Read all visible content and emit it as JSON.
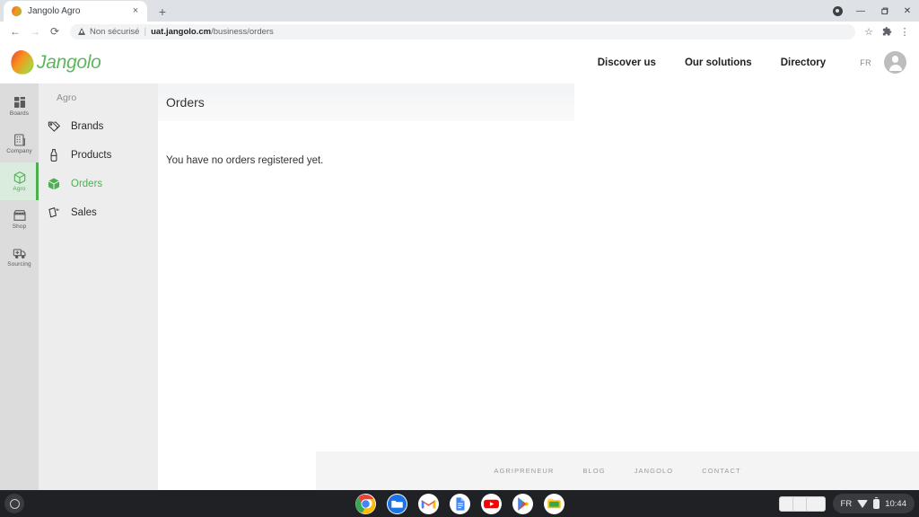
{
  "browser": {
    "tab": {
      "title": "Jangolo Agro",
      "favicon": "mango-favicon",
      "close": "×"
    },
    "newtab_label": "+",
    "window_controls": {
      "profile": "profile-dot",
      "minimize": "—",
      "maximize": "❐",
      "close": "✕"
    },
    "nav": {
      "back": "←",
      "forward": "→",
      "reload": "⟳"
    },
    "omnibox": {
      "security_label": "Non sécurisé",
      "separator": "|",
      "url_host": "uat.jangolo.cm",
      "url_path": "/business/orders"
    },
    "toolbar_icons": {
      "bookmark": "☆",
      "extensions": "puzzle-icon",
      "menu": "⋮"
    }
  },
  "site": {
    "logo_text": "Jangolo",
    "nav_links": [
      {
        "label": "Discover us"
      },
      {
        "label": "Our solutions"
      },
      {
        "label": "Directory"
      }
    ],
    "language": "FR",
    "account": "account-avatar"
  },
  "rail": {
    "items": [
      {
        "label": "Boards",
        "icon": "boards-icon",
        "active": false
      },
      {
        "label": "Company",
        "icon": "company-icon",
        "active": false
      },
      {
        "label": "Agro",
        "icon": "agro-box-icon",
        "active": true
      },
      {
        "label": "Shop",
        "icon": "shop-icon",
        "active": false
      },
      {
        "label": "Sourcing",
        "icon": "sourcing-truck-icon",
        "active": false
      }
    ]
  },
  "subnav": {
    "title": "Agro",
    "items": [
      {
        "label": "Brands",
        "icon": "tag-icon",
        "active": false
      },
      {
        "label": "Products",
        "icon": "bottle-icon",
        "active": false
      },
      {
        "label": "Orders",
        "icon": "box-icon",
        "active": true
      },
      {
        "label": "Sales",
        "icon": "banknote-icon",
        "active": false
      }
    ]
  },
  "main": {
    "page_title": "Orders",
    "empty_message": "You have no orders registered yet."
  },
  "footer": {
    "links": [
      {
        "label": "AGRIPRENEUR"
      },
      {
        "label": "BLOG"
      },
      {
        "label": "JANGOLO"
      },
      {
        "label": "CONTACT"
      }
    ]
  },
  "shelf": {
    "launcher": "launcher-icon",
    "apps": [
      {
        "name": "chrome-icon",
        "running": true
      },
      {
        "name": "files-icon",
        "running": false
      },
      {
        "name": "gmail-icon",
        "running": true
      },
      {
        "name": "docs-icon",
        "running": false
      },
      {
        "name": "youtube-icon",
        "running": true
      },
      {
        "name": "play-store-icon",
        "running": false
      },
      {
        "name": "photos-icon",
        "running": false
      }
    ],
    "tray": {
      "language": "FR",
      "wifi": "wifi-icon",
      "battery": "battery-icon",
      "time": "10:44"
    }
  },
  "colors": {
    "brand_green": "#4caf50",
    "rail_bg": "#dcdcdc",
    "subnav_bg": "#ededed"
  }
}
